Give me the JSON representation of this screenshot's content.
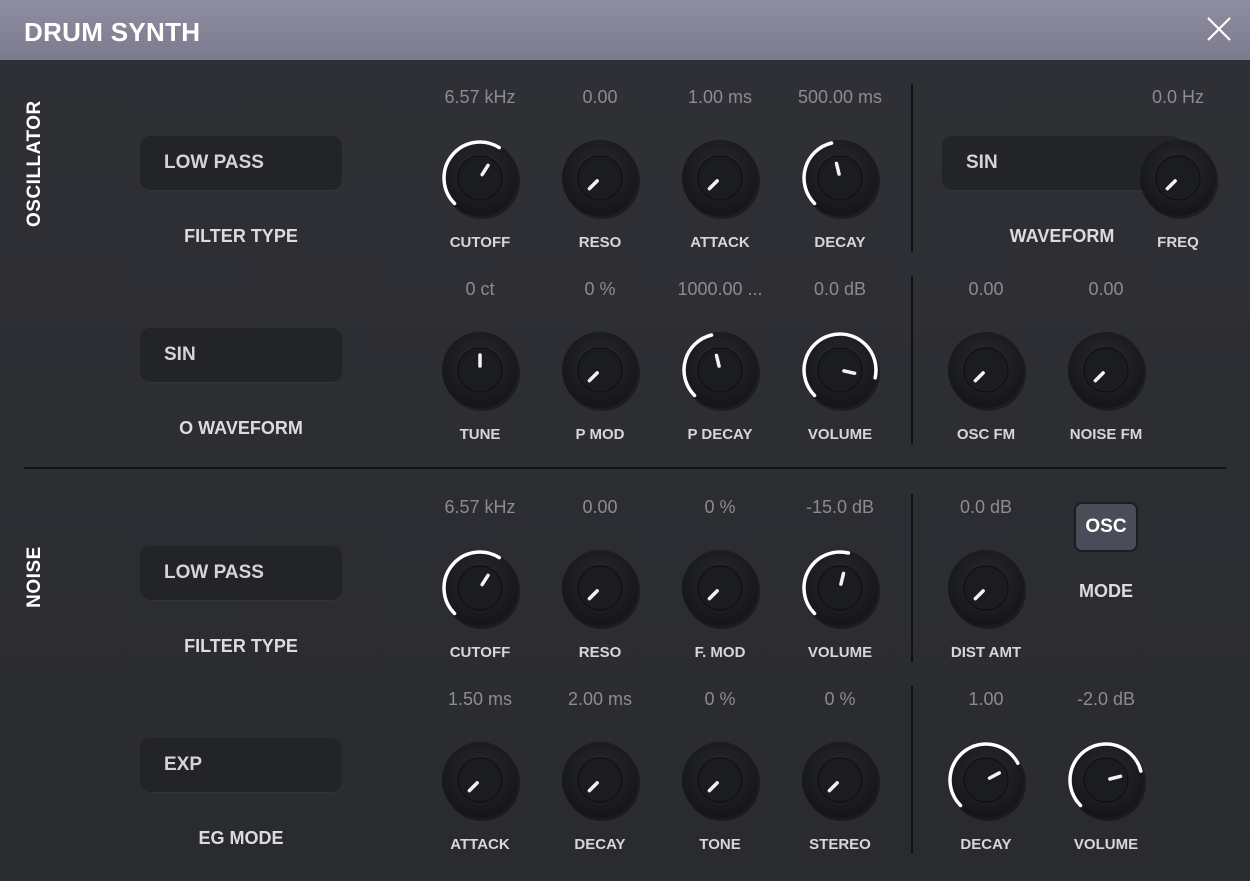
{
  "window": {
    "title": "DRUM SYNTH"
  },
  "colors": {
    "titlebar": "#8587a0",
    "panel": "#2c2d31",
    "knob_arc": "#ffffff",
    "value_text": "#8b8b92"
  },
  "sections": {
    "oscillator": "OSCILLATOR",
    "noise": "NOISE"
  },
  "dropdowns": [
    {
      "id": "osc-filter-type",
      "value": "LOW PASS",
      "label": "FILTER TYPE"
    },
    {
      "id": "osc-o-waveform",
      "value": "SIN",
      "label": "O WAVEFORM"
    },
    {
      "id": "osc-waveform",
      "value": "SIN",
      "label": "WAVEFORM"
    },
    {
      "id": "noise-filter-type",
      "value": "LOW PASS",
      "label": "FILTER TYPE"
    },
    {
      "id": "noise-eg-mode",
      "value": "EXP",
      "label": "EG MODE"
    }
  ],
  "knobs": [
    {
      "id": "osc-cutoff",
      "label": "CUTOFF",
      "value": "6.57 kHz",
      "level": 0.62,
      "arc": true
    },
    {
      "id": "osc-reso",
      "label": "RESO",
      "value": "0.00",
      "level": 0,
      "arc": false
    },
    {
      "id": "osc-attack",
      "label": "ATTACK",
      "value": "1.00 ms",
      "level": 0,
      "arc": false
    },
    {
      "id": "osc-decay",
      "label": "DECAY",
      "value": "500.00 ms",
      "level": 0.45,
      "arc": true
    },
    {
      "id": "osc-freq",
      "label": "FREQ",
      "value": "0.0 Hz",
      "level": 0,
      "arc": false
    },
    {
      "id": "osc-tune",
      "label": "TUNE",
      "value": "0 ct",
      "level": 0.5,
      "arc": false
    },
    {
      "id": "osc-pmod",
      "label": "P MOD",
      "value": "0 %",
      "level": 0,
      "arc": false
    },
    {
      "id": "osc-pdecay",
      "label": "P DECAY",
      "value": "1000.00 ...",
      "level": 0.45,
      "arc": true
    },
    {
      "id": "osc-volume",
      "label": "VOLUME",
      "value": "0.0 dB",
      "level": 0.88,
      "arc": true
    },
    {
      "id": "osc-oscfm",
      "label": "OSC FM",
      "value": "0.00",
      "level": 0,
      "arc": false
    },
    {
      "id": "osc-noisefm",
      "label": "NOISE FM",
      "value": "0.00",
      "level": 0,
      "arc": false
    },
    {
      "id": "noise-cutoff",
      "label": "CUTOFF",
      "value": "6.57 kHz",
      "level": 0.62,
      "arc": true
    },
    {
      "id": "noise-reso",
      "label": "RESO",
      "value": "0.00",
      "level": 0,
      "arc": false
    },
    {
      "id": "noise-fmod",
      "label": "F. MOD",
      "value": "0 %",
      "level": 0,
      "arc": false
    },
    {
      "id": "noise-volume",
      "label": "VOLUME",
      "value": "-15.0 dB",
      "level": 0.55,
      "arc": true
    },
    {
      "id": "noise-distamt",
      "label": "DIST AMT",
      "value": "0.0 dB",
      "level": 0,
      "arc": false
    },
    {
      "id": "noise-attack",
      "label": "ATTACK",
      "value": "1.50 ms",
      "level": 0,
      "arc": false
    },
    {
      "id": "noise-decay",
      "label": "DECAY",
      "value": "2.00 ms",
      "level": 0,
      "arc": false
    },
    {
      "id": "noise-tone",
      "label": "TONE",
      "value": "0 %",
      "level": 0,
      "arc": false
    },
    {
      "id": "noise-stereo",
      "label": "STEREO",
      "value": "0 %",
      "level": 0,
      "arc": false
    },
    {
      "id": "noise-eg-decay",
      "label": "DECAY",
      "value": "1.00",
      "level": 0.73,
      "arc": true
    },
    {
      "id": "noise-eg-volume",
      "label": "VOLUME",
      "value": "-2.0 dB",
      "level": 0.78,
      "arc": true
    }
  ],
  "mode": {
    "button": "OSC",
    "label": "MODE"
  }
}
